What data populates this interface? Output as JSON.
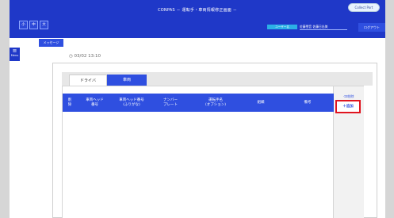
{
  "header": {
    "app_title": "CONPAS － 運転手・車両情報修正画面 －",
    "pill_label": "Collect Port",
    "quick_buttons": [
      "小",
      "中",
      "大"
    ],
    "user_badge": "ユーザー名",
    "user_info": "佐藤雪音 佐藤日出美",
    "logout_label": "ログアウト",
    "message_tab": "メッセージ"
  },
  "menu": {
    "icon": "≡",
    "label": "Menu"
  },
  "datetime": "◷ 03/02 13:10",
  "tabs": [
    {
      "label": "ドライバ",
      "active": false
    },
    {
      "label": "車両",
      "active": true
    }
  ],
  "table": {
    "columns": [
      {
        "line1": "削",
        "line2": "除"
      },
      {
        "line1": "車両ヘッド",
        "line2": "番号"
      },
      {
        "line1": "車両ヘッド番号",
        "line2": "(ふりがな)"
      },
      {
        "line1": "ナンバー",
        "line2": "プレート"
      },
      {
        "line1": "運転手名",
        "line2": "(オプション)"
      },
      {
        "line1": "組織",
        "line2": ""
      },
      {
        "line1": "備考",
        "line2": ""
      }
    ],
    "rows": []
  },
  "actions": {
    "delete_label": "⌫削除",
    "add_label": "＋追加"
  },
  "colors": {
    "header_blue": "#1f38c8",
    "accent_blue": "#2f4fe0",
    "highlight_red": "#e0141f"
  }
}
